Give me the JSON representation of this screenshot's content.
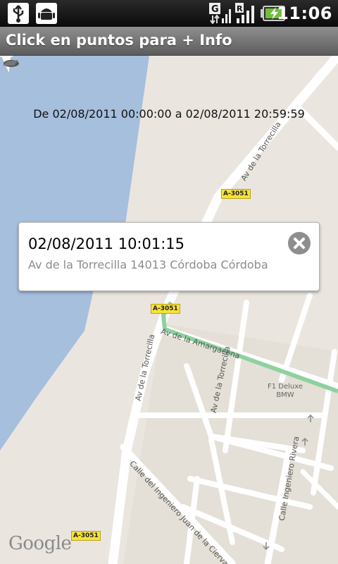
{
  "status_bar": {
    "time": "11:06",
    "icons": [
      "usb-icon",
      "android-debug-icon",
      "gprs-signal-icon",
      "roaming-signal-icon",
      "battery-charging-icon"
    ]
  },
  "title_bar": {
    "title": "Click en puntos para + Info"
  },
  "map": {
    "date_range": "De 02/08/2011 00:00:00 a 02/08/2011 20:59:59",
    "road_labels": {
      "torrecilla_top": "Av de la Torrecilla",
      "torrecilla_left": "Av de la Torrecilla",
      "torrecilla_mid": "Av de la Torrecilla",
      "amargacena": "Av de la Amargacena",
      "ingeniero_juan": "Calle del Ingeniero Juan de la Cierva",
      "ingeniero_rivera": "Calle Ingeniero Rivera"
    },
    "shields": {
      "top": "A-3051",
      "middle": "A-3051",
      "bottom": "A-3051"
    },
    "poi": {
      "line1": "F1 Deluxe",
      "line2": "BMW"
    },
    "brand": "Google",
    "colors": {
      "land": "#eae6df",
      "river": "#a5bfdd",
      "road": "#ffffff",
      "route": "#8fd19e"
    }
  },
  "balloon": {
    "title": "02/08/2011 10:01:15",
    "address": "Av de la Torrecilla 14013 Córdoba Córdoba"
  }
}
